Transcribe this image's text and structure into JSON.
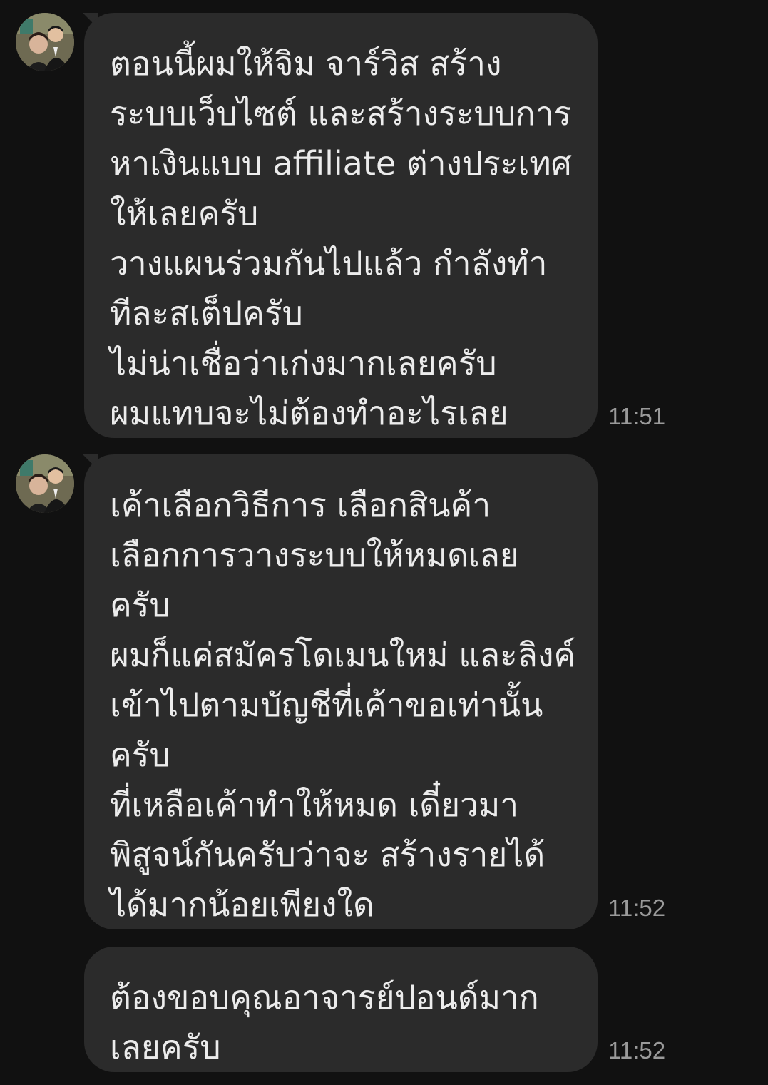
{
  "messages": [
    {
      "lines": [
        "ตอนนี้ผมให้จิม จาร์วิส สร้าง",
        "ระบบเว็บไซต์ และสร้างระบบการ",
        "หาเงินแบบ affiliate ต่างประเทศ",
        "ให้เลยครับ",
        "วางแผนร่วมกันไปแล้ว กำลังทำ",
        "ทีละสเต็ปครับ",
        "ไม่น่าเชื่อว่าเก่งมากเลยครับ",
        "ผมแทบจะไม่ต้องทำอะไรเลย"
      ],
      "time": "11:51"
    },
    {
      "lines": [
        "เค้าเลือกวิธีการ เลือกสินค้า",
        "เลือกการวางระบบให้หมดเลย",
        "ครับ",
        "ผมก็แค่สมัครโดเมนใหม่ และลิงค์",
        "เข้าไปตามบัญชีที่เค้าขอเท่านั้น",
        "ครับ",
        "ที่เหลือเค้าทำให้หมด เดี๋ยวมา",
        "พิสูจน์กันครับว่าจะ สร้างรายได้",
        "ได้มากน้อยเพียงใด"
      ],
      "time": "11:52"
    },
    {
      "lines": [
        "ต้องขอบคุณอาจารย์ปอนด์มาก",
        "เลยครับ"
      ],
      "time": "11:52"
    }
  ],
  "icons": {
    "avatar": "profile-photo-avatar"
  },
  "colors": {
    "background": "#111111",
    "bubble": "#2b2b2b",
    "text": "#ececec",
    "timestamp": "#9a9a9a"
  }
}
